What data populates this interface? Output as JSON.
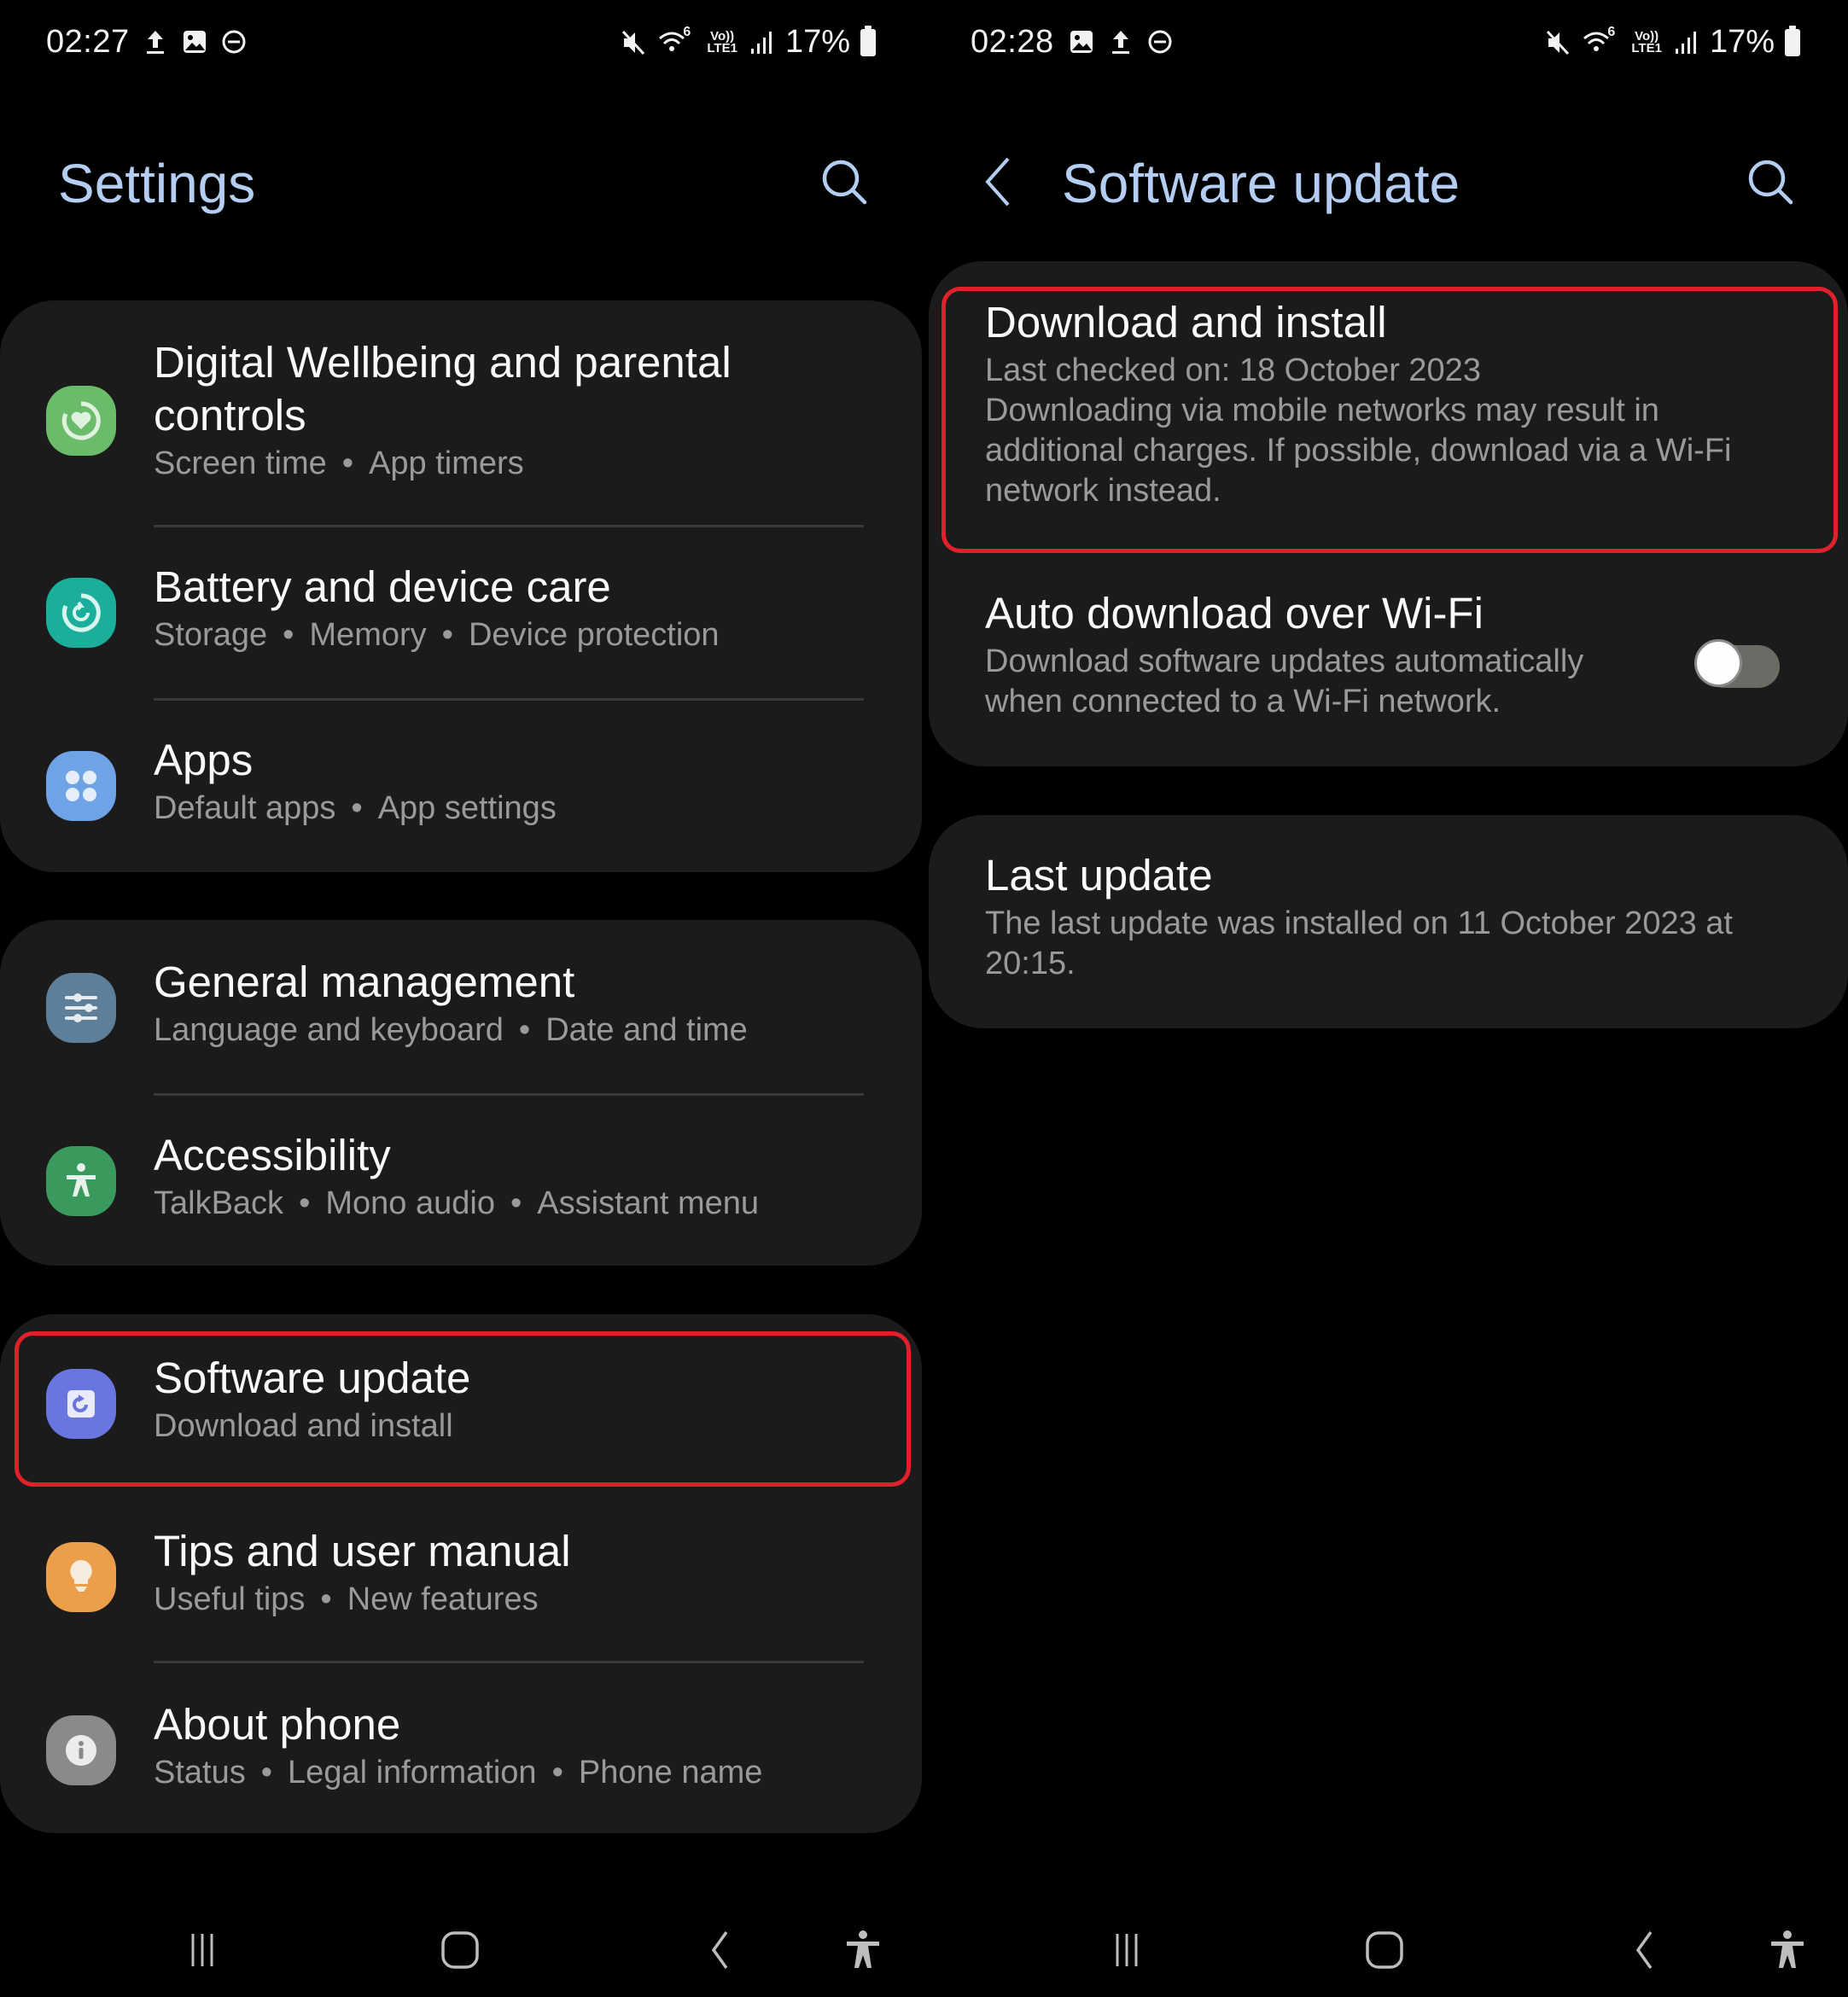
{
  "left_screen": {
    "status_bar": {
      "time": "02:27",
      "left_icons": [
        "upload-icon",
        "gallery-icon",
        "do-not-disturb-icon"
      ],
      "right_icons": [
        "mute-icon",
        "wifi6-icon",
        "volte-lte-icon",
        "signal-icon"
      ],
      "wifi_badge": "6",
      "volte_top": "Vo))",
      "volte_bottom": "LTE1",
      "battery": "17%"
    },
    "header": {
      "title": "Settings",
      "search_icon": "search-icon"
    },
    "groups": [
      {
        "items": [
          {
            "title": "Digital Wellbeing and parental controls",
            "subtitle": [
              "Screen time",
              "App timers"
            ],
            "icon": "digital-wellbeing-icon",
            "color": "#6bbc6a"
          },
          {
            "title": "Battery and device care",
            "subtitle": [
              "Storage",
              "Memory",
              "Device protection"
            ],
            "icon": "device-care-icon",
            "color": "#1aae9b"
          },
          {
            "title": "Apps",
            "subtitle": [
              "Default apps",
              "App settings"
            ],
            "icon": "apps-icon",
            "color": "#6ea3e6"
          }
        ]
      },
      {
        "items": [
          {
            "title": "General management",
            "subtitle": [
              "Language and keyboard",
              "Date and time"
            ],
            "icon": "general-management-icon",
            "color": "#5e7f99"
          },
          {
            "title": "Accessibility",
            "subtitle": [
              "TalkBack",
              "Mono audio",
              "Assistant menu"
            ],
            "icon": "accessibility-icon",
            "color": "#3a9a5e"
          }
        ]
      },
      {
        "items": [
          {
            "title": "Software update",
            "subtitle": [
              "Download and install"
            ],
            "icon": "software-update-icon",
            "color": "#6a76e0",
            "highlighted": true
          },
          {
            "title": "Tips and user manual",
            "subtitle": [
              "Useful tips",
              "New features"
            ],
            "icon": "tips-icon",
            "color": "#eb9f4a"
          },
          {
            "title": "About phone",
            "subtitle": [
              "Status",
              "Legal information",
              "Phone name"
            ],
            "icon": "about-phone-icon",
            "color": "#8a8a8a"
          }
        ]
      }
    ]
  },
  "right_screen": {
    "status_bar": {
      "time": "02:28",
      "left_icons": [
        "gallery-icon",
        "upload-icon",
        "do-not-disturb-icon"
      ],
      "wifi_badge": "6",
      "volte_top": "Vo))",
      "volte_bottom": "LTE1",
      "battery": "17%"
    },
    "header": {
      "title": "Software update",
      "back_icon": "back-icon",
      "search_icon": "search-icon"
    },
    "download": {
      "title": "Download and install",
      "lines": [
        "Last checked on: 18 October 2023",
        "Downloading via mobile networks may result in additional charges. If possible, download via a Wi-Fi network instead."
      ],
      "highlighted": true
    },
    "auto_download": {
      "title": "Auto download over Wi-Fi",
      "subtitle": "Download software updates automatically when connected to a Wi-Fi network.",
      "enabled": false
    },
    "last_update": {
      "title": "Last update",
      "subtitle": "The last update was installed on 11 October 2023 at 20:15."
    }
  },
  "navbar": {
    "buttons": [
      "recents-icon",
      "home-icon",
      "back-icon",
      "accessibility-shortcut-icon"
    ]
  },
  "colors": {
    "title_accent": "#b4cdf2",
    "highlight": "#e0212b",
    "card": "#1b1b1b"
  }
}
